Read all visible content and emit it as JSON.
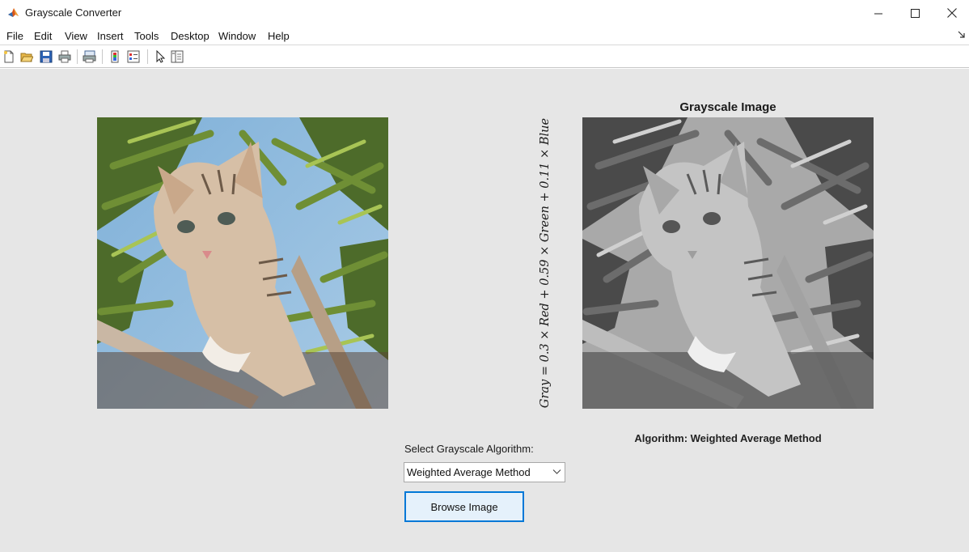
{
  "window": {
    "title": "Grayscale Converter",
    "app_icon": "matlab-membrane-icon",
    "controls": [
      "minimize-icon",
      "maximize-icon",
      "close-icon"
    ]
  },
  "menubar": {
    "items": [
      "File",
      "Edit",
      "View",
      "Insert",
      "Tools",
      "Desktop",
      "Window",
      "Help"
    ]
  },
  "toolbar": {
    "buttons": [
      "new-figure-icon",
      "open-file-icon",
      "save-icon",
      "print-icon",
      "print-preview-icon",
      "colorbar-icon",
      "legend-icon",
      "pointer-icon",
      "property-inspector-icon"
    ]
  },
  "axes": {
    "original_image": "color photo of a tabby cat on a tree branch among leaves",
    "grayscale_title": "Grayscale Image",
    "grayscale_image": "grayscale version of the cat photo",
    "formula": "Gray = 0.3 × Red + 0.59 × Green + 0.11 × Blue",
    "algorithm_label": "Algorithm: Weighted Average Method"
  },
  "controls": {
    "select_label": "Select Grayscale Algorithm:",
    "dropdown_value": "Weighted Average Method",
    "browse_button": "Browse Image"
  },
  "colors": {
    "figure_background": "#e6e6e6",
    "button_focus_border": "#0078d7",
    "button_background": "#e5f1fb"
  }
}
